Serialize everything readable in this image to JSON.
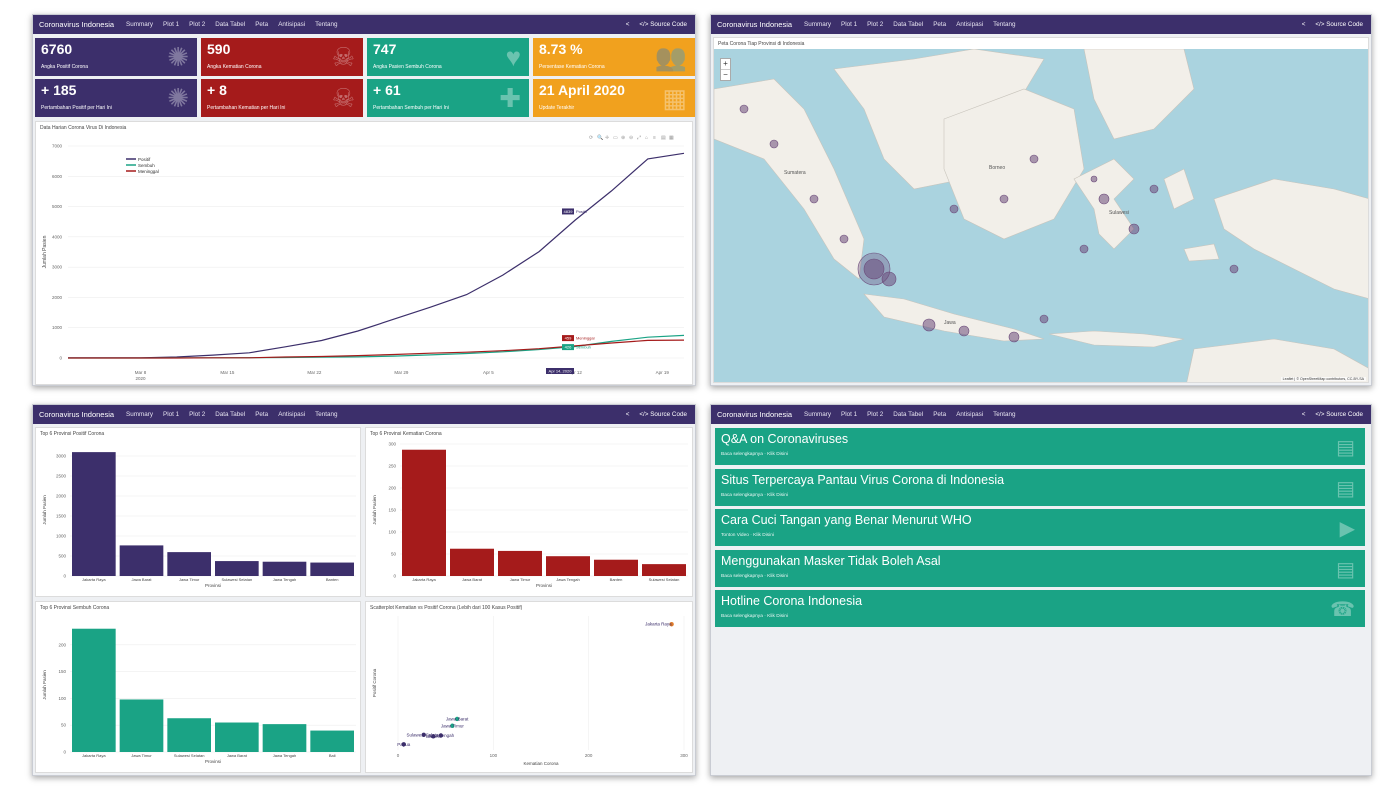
{
  "nav": {
    "brand": "Coronavirus Indonesia",
    "items": [
      "Summary",
      "Plot 1",
      "Plot 2",
      "Data Tabel",
      "Peta",
      "Antisipasi",
      "Tentang"
    ],
    "source": "Source Code",
    "share_icon": "share-icon",
    "code_icon": "code-icon"
  },
  "colors": {
    "navy": "#3c2f6b",
    "red": "#a51b1b",
    "green": "#1aa385",
    "orange": "#f1a11e"
  },
  "valueboxes": [
    {
      "value": "6760",
      "caption": "Angka Positif Corona",
      "color": "navy",
      "icon": "virus-icon"
    },
    {
      "value": "590",
      "caption": "Angka Kematian Corona",
      "color": "red",
      "icon": "skull-icon"
    },
    {
      "value": "747",
      "caption": "Angka Pasien Sembuh Corona",
      "color": "green",
      "icon": "heart-icon"
    },
    {
      "value": "8.73 %",
      "caption": "Persentase Kematian Corona",
      "color": "orange",
      "icon": "people-icon"
    },
    {
      "value": "+ 185",
      "caption": "Pertambahan Positif per Hari Ini",
      "color": "navy",
      "icon": "virus-icon"
    },
    {
      "value": "+ 8",
      "caption": "Pertambahan Kematian per Hari Ini",
      "color": "red",
      "icon": "skull-icon"
    },
    {
      "value": "+ 61",
      "caption": "Pertambahan Sembuh per Hari Ini",
      "color": "green",
      "icon": "heart-plus-icon"
    },
    {
      "value": "21 April 2020",
      "caption": "Update Terakhir",
      "color": "orange",
      "icon": "calendar-icon"
    }
  ],
  "line_title": "Data Harian Corona Virus Di Indonesia",
  "map_title": "Peta Corona Tiap Provinsi di Indonesia",
  "map": {
    "zoom_in": "+",
    "zoom_out": "−",
    "attribution": "Leaflet | © OpenStreetMap contributors, CC-BY-SA",
    "labels": [
      "Borneo",
      "Sulawesi",
      "Jawa",
      "Sumatera"
    ]
  },
  "articles": [
    {
      "title": "Q&A on Coronaviruses",
      "sub": "Baca selengkapnya · Klik Disini",
      "icon": "document-icon"
    },
    {
      "title": "Situs Terpercaya Pantau Virus Corona di Indonesia",
      "sub": "Baca selengkapnya · Klik Disini",
      "icon": "document-icon"
    },
    {
      "title": "Cara Cuci Tangan yang Benar Menurut WHO",
      "sub": "Tonton Video · Klik Disini",
      "icon": "video-icon"
    },
    {
      "title": "Menggunakan Masker Tidak Boleh Asal",
      "sub": "Baca selengkapnya · Klik Disini",
      "icon": "document-icon"
    },
    {
      "title": "Hotline Corona Indonesia",
      "sub": "Baca selengkapnya · Klik Disini",
      "icon": "phone-icon"
    }
  ],
  "chart_data": [
    {
      "id": "line",
      "type": "line",
      "title": "Data Harian Corona Virus Di Indonesia",
      "xlabel": "Tanggal",
      "ylabel": "Jumlah Pasien",
      "ylim": [
        0,
        7000
      ],
      "x_ticks": [
        "Mar 8\n2020",
        "Mar 15",
        "Mar 22",
        "Mar 29",
        "Apr 5",
        "Apr 12",
        "Apr 19"
      ],
      "x": [
        "Mar 2",
        "Mar 5",
        "Mar 8",
        "Mar 11",
        "Mar 14",
        "Mar 17",
        "Mar 20",
        "Mar 23",
        "Mar 26",
        "Mar 29",
        "Apr 1",
        "Apr 4",
        "Apr 7",
        "Apr 10",
        "Apr 13",
        "Apr 16",
        "Apr 19",
        "Apr 21"
      ],
      "legend_position": "top-left",
      "series": [
        {
          "name": "Positif",
          "color": "#3c2f6b",
          "values": [
            2,
            4,
            6,
            34,
            96,
            172,
            369,
            579,
            893,
            1285,
            1677,
            2092,
            2738,
            3512,
            4557,
            5516,
            6575,
            6760
          ]
        },
        {
          "name": "Sembuh",
          "color": "#1aa385",
          "values": [
            0,
            0,
            0,
            2,
            8,
            9,
            16,
            30,
            35,
            64,
            103,
            150,
            204,
            282,
            380,
            548,
            686,
            747
          ]
        },
        {
          "name": "Meninggal",
          "color": "#a51b1b",
          "values": [
            0,
            0,
            0,
            1,
            5,
            7,
            32,
            48,
            78,
            114,
            157,
            191,
            240,
            306,
            399,
            496,
            582,
            590
          ]
        }
      ],
      "hover": {
        "date": "Apr 14, 2020",
        "positif": "4839",
        "meninggal": "459",
        "sembuh": "426"
      }
    },
    {
      "id": "bar-pos",
      "type": "bar",
      "title": "Top 6 Provinsi Positif Corona",
      "xlabel": "Provinsi",
      "ylabel": "Jumlah Pasien",
      "ylim": [
        0,
        3300
      ],
      "y_ticks": [
        0,
        500,
        1000,
        1500,
        2000,
        2500,
        3000
      ],
      "color": "#3c2f6b",
      "categories": [
        "Jakarta Raya",
        "Jawa Barat",
        "Jawa Timur",
        "Sulawesi Selatan",
        "Jawa Tengah",
        "Banten"
      ],
      "values": [
        3097,
        765,
        597,
        373,
        357,
        336
      ]
    },
    {
      "id": "bar-death",
      "type": "bar",
      "title": "Top 6 Provinsi Kematian Corona",
      "xlabel": "Provinsi",
      "ylabel": "Jumlah Pasien",
      "ylim": [
        0,
        300
      ],
      "y_ticks": [
        0,
        50,
        100,
        150,
        200,
        250,
        300
      ],
      "color": "#a51b1b",
      "categories": [
        "Jakarta Raya",
        "Jawa Barat",
        "Jawa Timur",
        "Jawa Tengah",
        "Banten",
        "Sulawesi Selatan"
      ],
      "values": [
        287,
        62,
        57,
        45,
        37,
        27
      ]
    },
    {
      "id": "bar-rec",
      "type": "bar",
      "title": "Top 6 Provinsi Sembuh Corona",
      "xlabel": "Provinsi",
      "ylabel": "Jumlah Pasien",
      "ylim": [
        0,
        250
      ],
      "y_ticks": [
        0,
        50,
        100,
        150,
        200
      ],
      "color": "#1aa385",
      "categories": [
        "Jakarta Raya",
        "Jawa Timur",
        "Sulawesi Selatan",
        "Jawa Barat",
        "Jawa Tengah",
        "Bali"
      ],
      "values": [
        230,
        98,
        63,
        55,
        52,
        40
      ]
    },
    {
      "id": "scatter",
      "type": "scatter",
      "title": "Scatterplot Kematian vs Positif Corona (Lebih dari 100 Kasus Positif)",
      "xlabel": "Kematian Corona",
      "ylabel": "Positif Corona",
      "xlim": [
        0,
        300
      ],
      "ylim": [
        0,
        3300
      ],
      "x_ticks": [
        0,
        100,
        200,
        300
      ],
      "points": [
        {
          "label": "Jakarta Raya",
          "x": 287,
          "y": 3097,
          "color": "#e07b2a"
        },
        {
          "label": "Jawa Barat",
          "x": 62,
          "y": 765,
          "color": "#1aa385"
        },
        {
          "label": "Jawa Timur",
          "x": 57,
          "y": 597,
          "color": "#1aa385"
        },
        {
          "label": "Sulawesi Selatan",
          "x": 27,
          "y": 373,
          "color": "#3c2f6b"
        },
        {
          "label": "Jawa Tengah",
          "x": 45,
          "y": 357,
          "color": "#3c2f6b"
        },
        {
          "label": "Banten",
          "x": 37,
          "y": 336,
          "color": "#3c2f6b"
        },
        {
          "label": "Papua",
          "x": 6,
          "y": 140,
          "color": "#3c2f6b"
        }
      ]
    }
  ]
}
